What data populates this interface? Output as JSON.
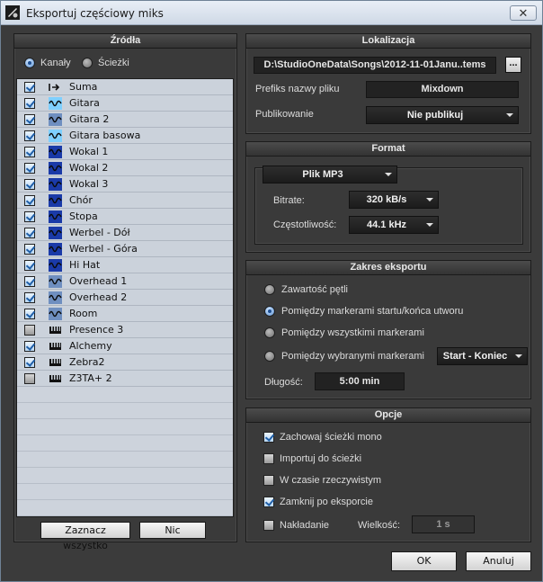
{
  "window": {
    "title": "Eksportuj częściowy miks",
    "close_label": "✕"
  },
  "sources": {
    "header": "Źródła",
    "mode_channels": "Kanały",
    "mode_tracks": "Ścieżki",
    "mode_selected": "channels",
    "tracks": [
      {
        "name": "Suma",
        "checked": true,
        "icon": "master-bus-icon"
      },
      {
        "name": "Gitara",
        "checked": true,
        "icon": "audio-wave-icon"
      },
      {
        "name": "Gitara 2",
        "checked": true,
        "icon": "audio-wave-icon"
      },
      {
        "name": "Gitara basowa",
        "checked": true,
        "icon": "audio-wave-icon"
      },
      {
        "name": "Wokal 1",
        "checked": true,
        "icon": "audio-wave-icon"
      },
      {
        "name": "Wokal 2",
        "checked": true,
        "icon": "audio-wave-icon"
      },
      {
        "name": "Wokal 3",
        "checked": true,
        "icon": "audio-wave-icon"
      },
      {
        "name": "Chór",
        "checked": true,
        "icon": "audio-wave-icon"
      },
      {
        "name": "Stopa",
        "checked": true,
        "icon": "audio-wave-icon"
      },
      {
        "name": "Werbel - Dół",
        "checked": true,
        "icon": "audio-wave-icon"
      },
      {
        "name": "Werbel - Góra",
        "checked": true,
        "icon": "audio-wave-icon"
      },
      {
        "name": "Hi Hat",
        "checked": true,
        "icon": "audio-wave-icon"
      },
      {
        "name": "Overhead 1",
        "checked": true,
        "icon": "audio-wave-icon"
      },
      {
        "name": "Overhead 2",
        "checked": true,
        "icon": "audio-wave-icon"
      },
      {
        "name": "Room",
        "checked": true,
        "icon": "audio-wave-icon"
      },
      {
        "name": "Presence 3",
        "checked": false,
        "icon": "instrument-keyboard-icon"
      },
      {
        "name": "Alchemy",
        "checked": true,
        "icon": "instrument-keyboard-icon"
      },
      {
        "name": "Zebra2",
        "checked": true,
        "icon": "instrument-keyboard-icon"
      },
      {
        "name": "Z3TA+ 2",
        "checked": false,
        "icon": "instrument-keyboard-icon"
      }
    ],
    "select_all_label": "Zaznacz wszystko",
    "none_label": "Nic"
  },
  "location": {
    "header": "Lokalizacja",
    "path": "D:\\StudioOneData\\Songs\\2012-11-01Janu..tems",
    "browse_label": "...",
    "prefix_label": "Prefiks nazwy pliku",
    "prefix_value": "Mixdown",
    "publish_label": "Publikowanie",
    "publish_value": "Nie publikuj"
  },
  "format": {
    "header": "Format",
    "file_type": "Plik MP3",
    "bitrate_label": "Bitrate:",
    "bitrate_value": "320 kB/s",
    "frequency_label": "Częstotliwość:",
    "frequency_value": "44.1 kHz"
  },
  "export_range": {
    "header": "Zakres eksportu",
    "options": [
      {
        "label": "Zawartość pętli",
        "selected": false
      },
      {
        "label": "Pomiędzy markerami startu/końca utworu",
        "selected": true
      },
      {
        "label": "Pomiędzy wszystkimi markerami",
        "selected": false
      },
      {
        "label": "Pomiędzy wybranymi markerami",
        "selected": false
      }
    ],
    "markers_value": "Start - Koniec",
    "length_label": "Długość:",
    "length_value": "5:00 min"
  },
  "options": {
    "header": "Opcje",
    "keep_mono_label": "Zachowaj ścieżki mono",
    "keep_mono": true,
    "import_label": "Importuj do ścieżki",
    "import": false,
    "realtime_label": "W czasie rzeczywistym",
    "realtime": false,
    "close_after_label": "Zamknij po eksporcie",
    "close_after": true,
    "overlap_label": "Nakładanie",
    "overlap": false,
    "size_label": "Wielkość:",
    "size_value": "1 s"
  },
  "footer": {
    "ok_label": "OK",
    "cancel_label": "Anuluj"
  },
  "colors": {
    "accent": "#5a8fd0",
    "panel": "#3a3a3a",
    "list_bg": "#cfd6df",
    "wave_icon": "#1a3aa8"
  }
}
